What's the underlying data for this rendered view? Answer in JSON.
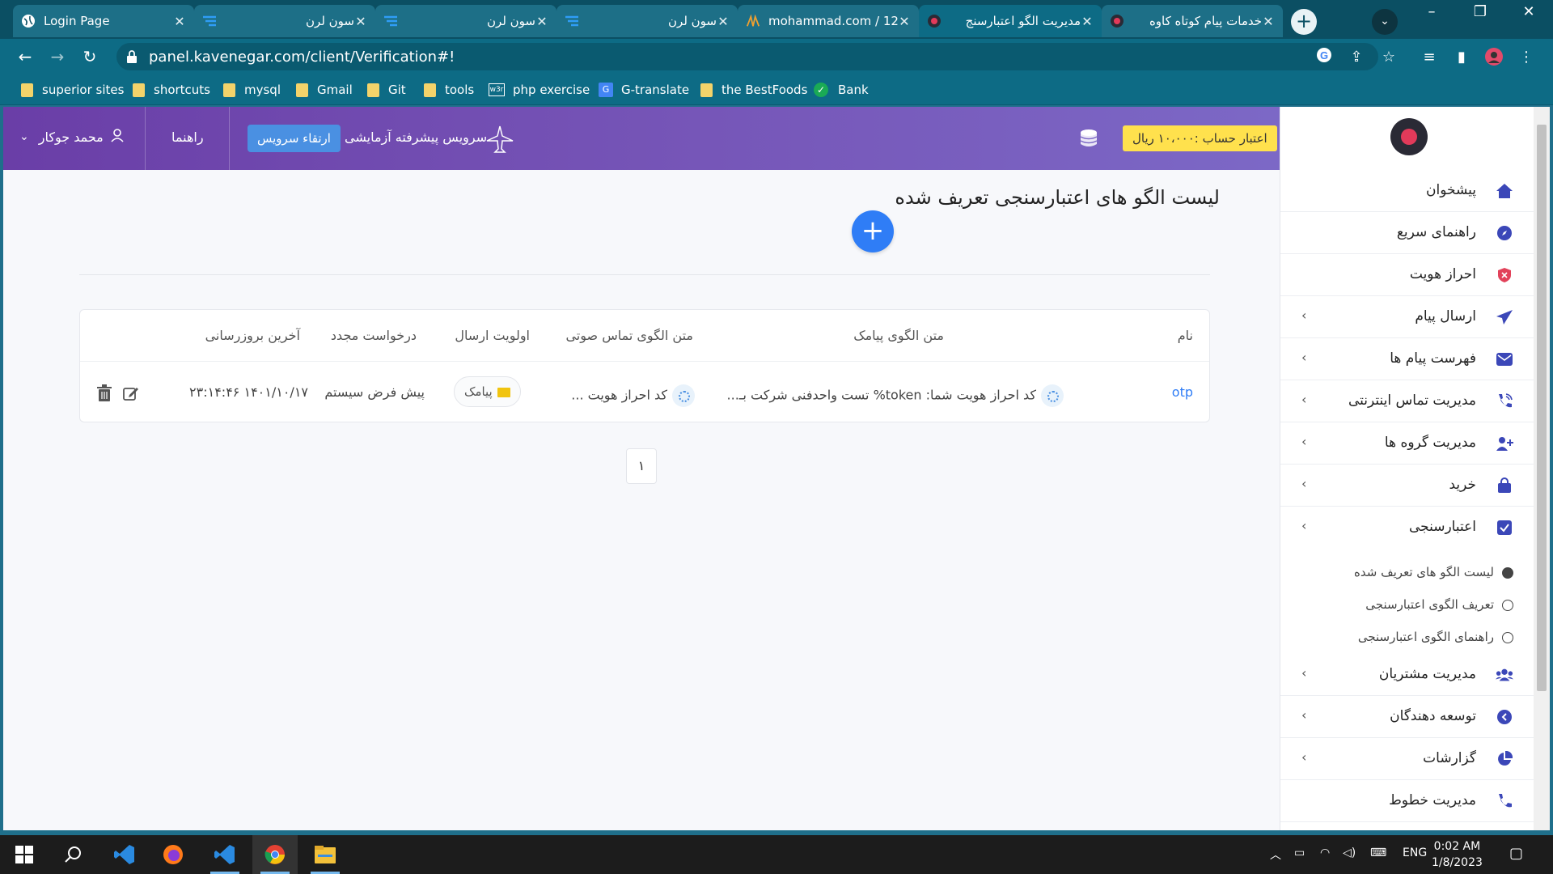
{
  "browser": {
    "tabs": [
      {
        "title": "Login Page",
        "active": false
      },
      {
        "title": "سون لرن",
        "active": false
      },
      {
        "title": "سون لرن",
        "active": false
      },
      {
        "title": "سون لرن",
        "active": false
      },
      {
        "title": "mohammad.com / 12",
        "active": false
      },
      {
        "title": "مدیریت الگو اعتبارسنج",
        "active": true
      },
      {
        "title": "خدمات پیام کوتاه کاوه",
        "active": false
      }
    ],
    "url": "panel.kavenegar.com/client/Verification#!",
    "bookmarks": [
      {
        "label": "superior sites",
        "icon": "folder-icon"
      },
      {
        "label": "shortcuts",
        "icon": "folder-icon"
      },
      {
        "label": "mysql",
        "icon": "folder-icon"
      },
      {
        "label": "Gmail",
        "icon": "folder-icon"
      },
      {
        "label": "Git",
        "icon": "folder-icon"
      },
      {
        "label": "tools",
        "icon": "folder-icon"
      },
      {
        "label": "php exercise",
        "icon": "w3-icon"
      },
      {
        "label": "G-translate",
        "icon": "translate-icon"
      },
      {
        "label": "the BestFoods",
        "icon": "folder-icon"
      },
      {
        "label": "Bank",
        "icon": "check-icon"
      }
    ]
  },
  "topbar": {
    "user_name": "محمد جوکار",
    "help": "راهنما",
    "upgrade": "ارتقاء سرویس",
    "trial": "سرویس پیشرفته آزمایشی",
    "credit": "اعتبار حساب :۱۰،۰۰۰ ریال"
  },
  "sidebar": {
    "items": [
      {
        "label": "پیشخوان",
        "icon": "home-icon",
        "chevron": false
      },
      {
        "label": "راهنمای سریع",
        "icon": "compass-icon",
        "chevron": false
      },
      {
        "label": "احراز هویت",
        "icon": "shield-icon",
        "chevron": false
      },
      {
        "label": "ارسال پیام",
        "icon": "send-icon",
        "chevron": true
      },
      {
        "label": "فهرست پیام ها",
        "icon": "envelope-icon",
        "chevron": true
      },
      {
        "label": "مدیریت تماس اینترنتی",
        "icon": "phone-volume-icon",
        "chevron": true
      },
      {
        "label": "مدیریت گروه ها",
        "icon": "user-plus-icon",
        "chevron": true
      },
      {
        "label": "خرید",
        "icon": "bag-icon",
        "chevron": true
      },
      {
        "label": "اعتبارسنجی",
        "icon": "check-square-icon",
        "chevron": true
      }
    ],
    "sub_items": [
      {
        "label": "لیست الگو های تعریف شده",
        "selected": true
      },
      {
        "label": "تعریف الگوی اعتبارسنجی",
        "selected": false
      },
      {
        "label": "راهنمای الگوی اعتبارسنجی",
        "selected": false
      }
    ],
    "items_bottom": [
      {
        "label": "مدیریت مشتریان",
        "icon": "users-icon",
        "chevron": true
      },
      {
        "label": "توسعه دهندگان",
        "icon": "code-icon",
        "chevron": true
      },
      {
        "label": "گزارشات",
        "icon": "pie-chart-icon",
        "chevron": true
      },
      {
        "label": "مدیریت خطوط",
        "icon": "phone-icon",
        "chevron": false
      }
    ]
  },
  "main": {
    "title": "لیست الگو های اعتبارسنجی تعریف شده",
    "columns": {
      "name": "نام",
      "sms_text": "متن الگوی پیامک",
      "voice_text": "متن الگوی تماس صوتی",
      "priority": "اولویت ارسال",
      "resend": "درخواست مجدد",
      "updated": "آخرین بروزرسانی"
    },
    "rows": [
      {
        "name": "otp",
        "sms_text": "کد احراز هویت شما: token% تست واحدفنی شرکت بـ...",
        "voice_text": "کد احراز هویت ...",
        "priority": "پیامک",
        "resend": "پیش فرض سیستم",
        "updated": "۱۴۰۱/۱۰/۱۷ ۲۳:۱۴:۴۶"
      }
    ],
    "page": "۱"
  },
  "taskbar": {
    "lang": "ENG",
    "time": "0:02 AM",
    "date": "1/8/2023"
  },
  "colors": {
    "topbar_gradient": [
      "#6a3ea7",
      "#7c68c6"
    ],
    "accent_blue": "#2f7df6",
    "credit_badge": "#ffe14d",
    "sidebar_icon": "#3b47b8"
  }
}
